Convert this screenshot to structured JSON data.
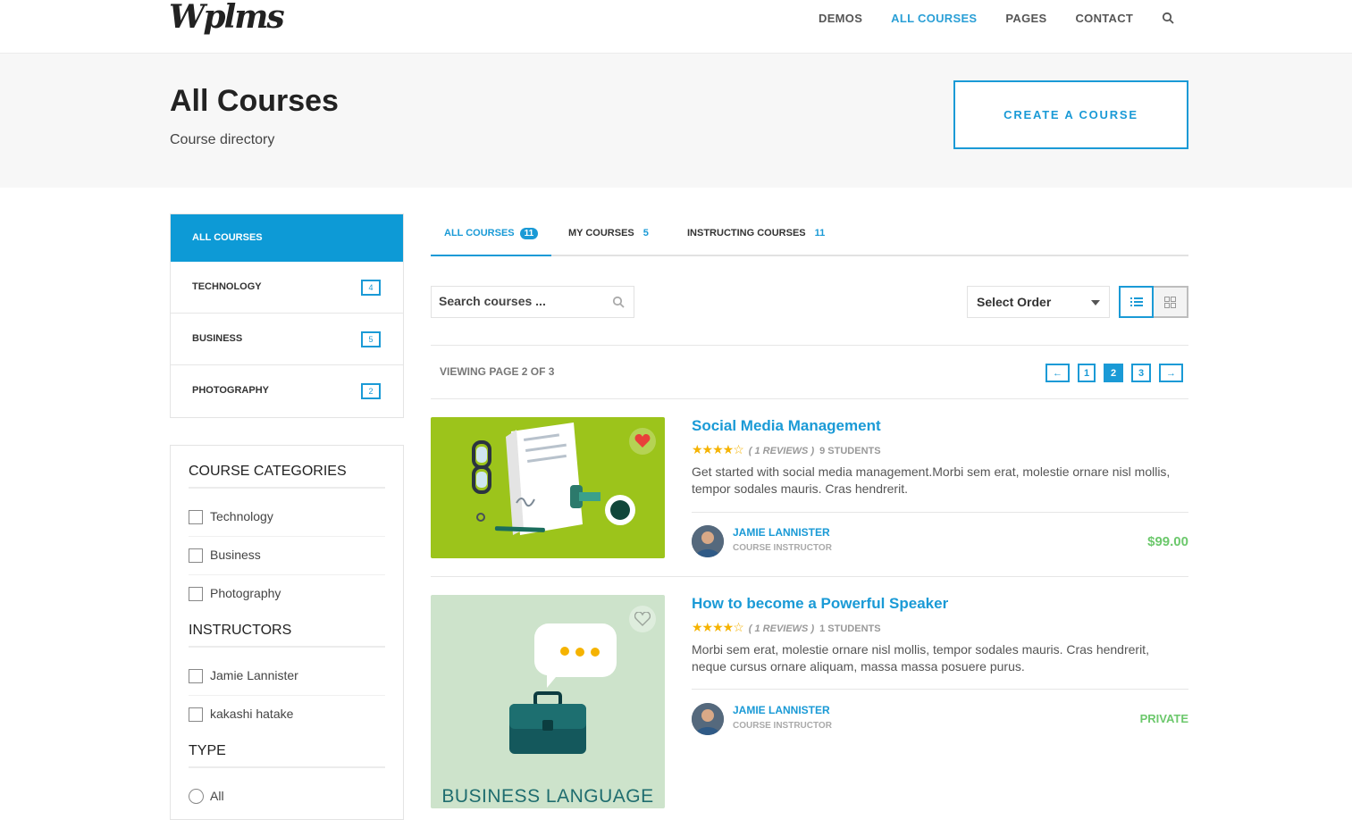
{
  "header": {
    "logo": "Wplms",
    "nav": [
      "DEMOS",
      "ALL COURSES",
      "PAGES",
      "CONTACT"
    ],
    "active_nav": "ALL COURSES"
  },
  "hero": {
    "title": "All Courses",
    "subtitle": "Course directory",
    "create_button": "CREATE A COURSE"
  },
  "directory": {
    "items": [
      {
        "label": "ALL COURSES",
        "count": ""
      },
      {
        "label": "TECHNOLOGY",
        "count": "4"
      },
      {
        "label": "BUSINESS",
        "count": "5"
      },
      {
        "label": "PHOTOGRAPHY",
        "count": "2"
      }
    ]
  },
  "filters": {
    "categories_title": "COURSE CATEGORIES",
    "categories": [
      "Technology",
      "Business",
      "Photography"
    ],
    "instructors_title": "INSTRUCTORS",
    "instructors": [
      "Jamie Lannister",
      "kakashi hatake"
    ],
    "type_title": "TYPE",
    "types": [
      "All"
    ]
  },
  "tabs": [
    {
      "label": "ALL COURSES",
      "count": "11"
    },
    {
      "label": "MY COURSES",
      "count": "5"
    },
    {
      "label": "INSTRUCTING COURSES",
      "count": "11"
    }
  ],
  "search": {
    "placeholder": "Search courses ..."
  },
  "order": {
    "label": "Select Order"
  },
  "pagination": {
    "viewing": "VIEWING PAGE 2 OF 3",
    "prev": "←",
    "pages": [
      "1",
      "2",
      "3"
    ],
    "current": "2",
    "next": "→"
  },
  "courses": [
    {
      "title": "Social Media Management",
      "rating": 4,
      "reviews": "( 1 REVIEWS )",
      "students": "9 STUDENTS",
      "description": "Get started with social media management.Morbi sem erat, molestie ornare nisl mollis, tempor sodales mauris. Cras hendrerit.",
      "instructor": "JAMIE LANNISTER",
      "instructor_role": "COURSE INSTRUCTOR",
      "price": "$99.00",
      "favorited": true,
      "thumb_color": "#9cc41b"
    },
    {
      "title": "How to become a Powerful Speaker",
      "rating": 4,
      "reviews": "( 1 REVIEWS )",
      "students": "1 STUDENTS",
      "description": "Morbi sem erat, molestie ornare nisl mollis, tempor sodales mauris. Cras hendrerit, neque cursus ornare aliquam, massa massa posuere purus.",
      "instructor": "JAMIE LANNISTER",
      "instructor_role": "COURSE INSTRUCTOR",
      "price": "PRIVATE",
      "favorited": false,
      "thumb_color": "#cde3cb",
      "thumb_text": "BUSINESS LANGUAGE"
    }
  ],
  "colors": {
    "accent": "#1a9ad6",
    "price": "#6cc86c"
  },
  "icons": [
    "search-icon",
    "list-view-icon",
    "grid-view-icon",
    "heart-icon",
    "caret-down-icon"
  ]
}
